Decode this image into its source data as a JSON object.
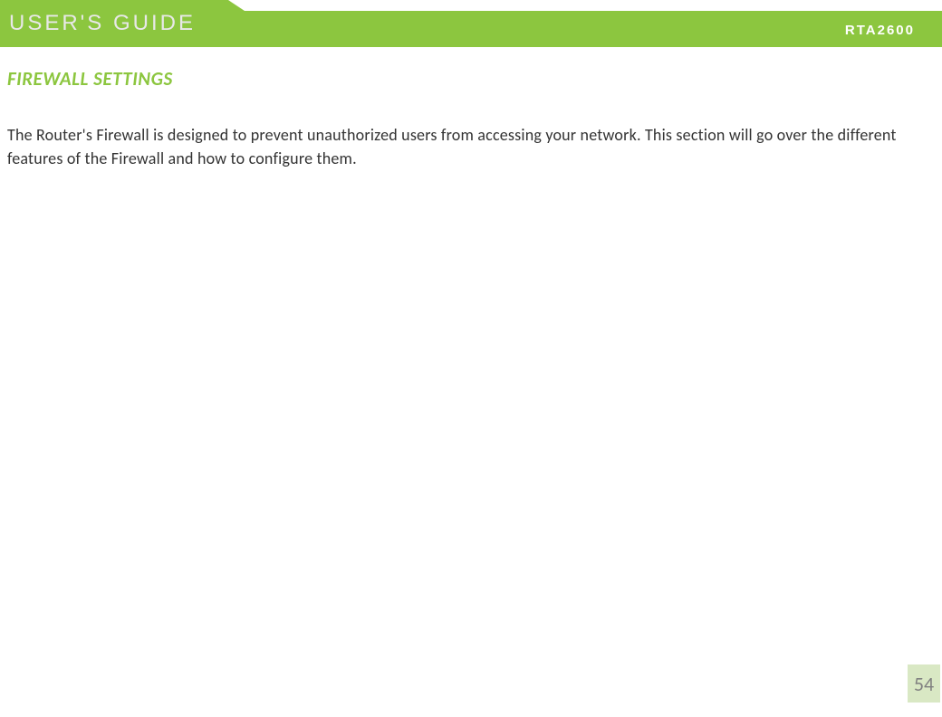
{
  "header": {
    "guide_title": "USER'S GUIDE",
    "model": "RTA2600"
  },
  "section": {
    "title": "FIREWALL SETTINGS",
    "body": "The Router's Firewall is designed to prevent unauthorized users from accessing your network. This section will go over the different features of the Firewall and how to configure them."
  },
  "page_number": "54"
}
